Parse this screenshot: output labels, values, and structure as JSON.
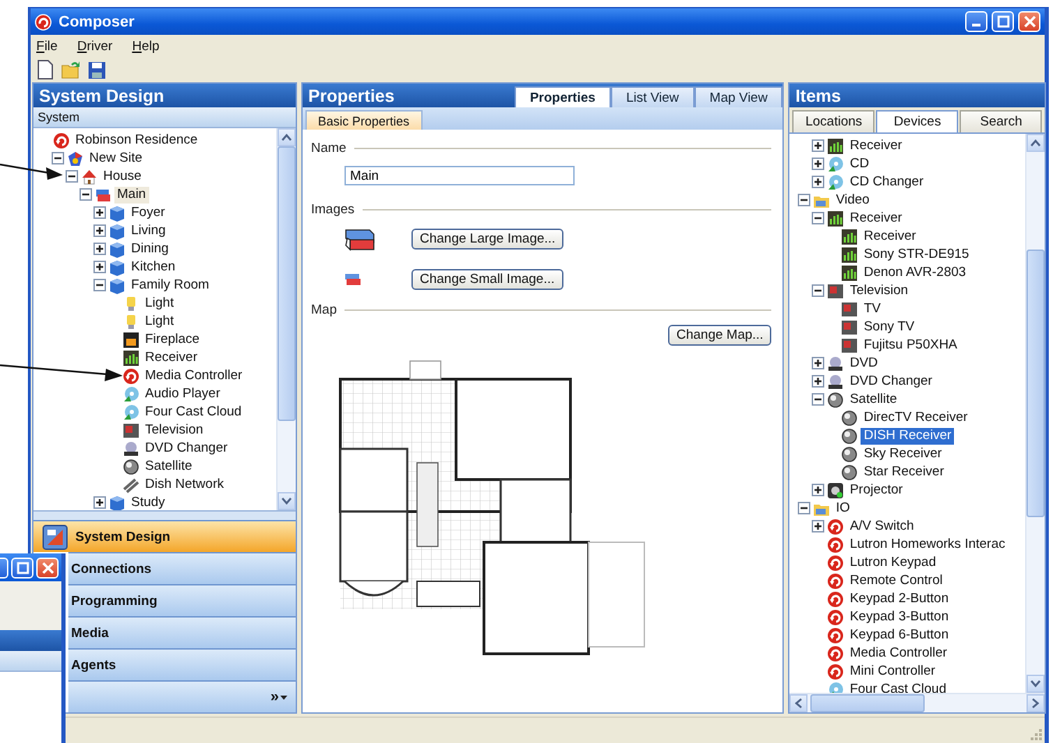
{
  "window": {
    "title": "Composer"
  },
  "menu": [
    "File",
    "Driver",
    "Help"
  ],
  "left_panel": {
    "title": "System Design",
    "subtitle": "System",
    "tree": [
      {
        "label": "Robinson Residence",
        "kind": "logo",
        "expandable": false,
        "selected": false,
        "children": [
          {
            "label": "New Site",
            "kind": "site",
            "expandable": true,
            "expanded": true,
            "selected": false,
            "children": [
              {
                "label": "House",
                "kind": "house",
                "expandable": true,
                "expanded": true,
                "selected": false,
                "children": [
                  {
                    "label": "Main",
                    "kind": "floor",
                    "expandable": true,
                    "expanded": true,
                    "selected": true,
                    "children": [
                      {
                        "label": "Foyer",
                        "kind": "room",
                        "expandable": true,
                        "expanded": false,
                        "selected": false
                      },
                      {
                        "label": "Living",
                        "kind": "room",
                        "expandable": true,
                        "expanded": false,
                        "selected": false
                      },
                      {
                        "label": "Dining",
                        "kind": "room",
                        "expandable": true,
                        "expanded": false,
                        "selected": false
                      },
                      {
                        "label": "Kitchen",
                        "kind": "room",
                        "expandable": true,
                        "expanded": false,
                        "selected": false
                      },
                      {
                        "label": "Family Room",
                        "kind": "room",
                        "expandable": true,
                        "expanded": true,
                        "selected": false,
                        "children": [
                          {
                            "label": "Light",
                            "kind": "light",
                            "expandable": false,
                            "selected": false
                          },
                          {
                            "label": "Light",
                            "kind": "light",
                            "expandable": false,
                            "selected": false
                          },
                          {
                            "label": "Fireplace",
                            "kind": "fireplace",
                            "expandable": false,
                            "selected": false
                          },
                          {
                            "label": "Receiver",
                            "kind": "receiver",
                            "expandable": false,
                            "selected": false
                          },
                          {
                            "label": "Media Controller",
                            "kind": "logo",
                            "expandable": false,
                            "selected": false
                          },
                          {
                            "label": "Audio Player",
                            "kind": "player",
                            "expandable": false,
                            "selected": false
                          },
                          {
                            "label": "Four Cast Cloud",
                            "kind": "player",
                            "expandable": false,
                            "selected": false
                          },
                          {
                            "label": "Television",
                            "kind": "tv",
                            "expandable": false,
                            "selected": false
                          },
                          {
                            "label": "DVD Changer",
                            "kind": "dvd",
                            "expandable": false,
                            "selected": false
                          },
                          {
                            "label": "Satellite",
                            "kind": "satellite",
                            "expandable": false,
                            "selected": false
                          },
                          {
                            "label": "Dish Network",
                            "kind": "cable",
                            "expandable": false,
                            "selected": false
                          }
                        ]
                      },
                      {
                        "label": "Study",
                        "kind": "room",
                        "expandable": true,
                        "expanded": false,
                        "selected": false
                      }
                    ]
                  }
                ]
              }
            ]
          }
        ]
      }
    ],
    "nav": [
      {
        "label": "System Design",
        "selected": true,
        "icon": true
      },
      {
        "label": "Connections",
        "selected": false,
        "icon": false
      },
      {
        "label": "Programming",
        "selected": false,
        "icon": false
      },
      {
        "label": "Media",
        "selected": false,
        "icon": false
      },
      {
        "label": "Agents",
        "selected": false,
        "icon": false
      }
    ],
    "nav_more": "»"
  },
  "properties": {
    "title": "Properties",
    "tabs": [
      {
        "label": "Properties",
        "selected": true
      },
      {
        "label": "List View",
        "selected": false
      },
      {
        "label": "Map View",
        "selected": false
      }
    ],
    "subtabs": [
      {
        "label": "Basic Properties",
        "selected": true
      }
    ],
    "name_label": "Name",
    "name_value": "Main",
    "images_label": "Images",
    "large_button": "Change Large Image...",
    "small_button": "Change Small Image...",
    "map_label": "Map",
    "map_button": "Change Map..."
  },
  "items_panel": {
    "title": "Items",
    "tabs": [
      {
        "label": "Locations",
        "selected": false
      },
      {
        "label": "Devices",
        "selected": true
      },
      {
        "label": "Search",
        "selected": false
      }
    ],
    "tree": [
      {
        "children": [
          {
            "label": "Receiver",
            "kind": "receiver",
            "expandable": true,
            "expanded": false,
            "selected": false
          },
          {
            "label": "CD",
            "kind": "player",
            "expandable": true,
            "expanded": false,
            "selected": false
          },
          {
            "label": "CD Changer",
            "kind": "player",
            "expandable": true,
            "expanded": false,
            "selected": false
          }
        ]
      },
      {
        "label": "Video",
        "kind": "folder",
        "expandable": true,
        "expanded": true,
        "selected": false,
        "children": [
          {
            "label": "Receiver",
            "kind": "receiver",
            "expandable": true,
            "expanded": true,
            "selected": false,
            "children": [
              {
                "label": "Receiver",
                "kind": "receiver",
                "expandable": false,
                "selected": false
              },
              {
                "label": "Sony STR-DE915",
                "kind": "receiver",
                "expandable": false,
                "selected": false
              },
              {
                "label": "Denon AVR-2803",
                "kind": "receiver",
                "expandable": false,
                "selected": false
              }
            ]
          },
          {
            "label": "Television",
            "kind": "tv",
            "expandable": true,
            "expanded": true,
            "selected": false,
            "children": [
              {
                "label": "TV",
                "kind": "tv",
                "expandable": false,
                "selected": false
              },
              {
                "label": "Sony TV",
                "kind": "tv",
                "expandable": false,
                "selected": false
              },
              {
                "label": "Fujitsu P50XHA",
                "kind": "tv",
                "expandable": false,
                "selected": false
              }
            ]
          },
          {
            "label": "DVD",
            "kind": "dvd",
            "expandable": true,
            "expanded": false,
            "selected": false
          },
          {
            "label": "DVD Changer",
            "kind": "dvd",
            "expandable": true,
            "expanded": false,
            "selected": false
          },
          {
            "label": "Satellite",
            "kind": "satellite",
            "expandable": true,
            "expanded": true,
            "selected": false,
            "children": [
              {
                "label": "DirecTV Receiver",
                "kind": "satellite",
                "expandable": false,
                "selected": false
              },
              {
                "label": "DISH Receiver",
                "kind": "satellite",
                "expandable": false,
                "selected": true
              },
              {
                "label": "Sky Receiver",
                "kind": "satellite",
                "expandable": false,
                "selected": false
              },
              {
                "label": "Star Receiver",
                "kind": "satellite",
                "expandable": false,
                "selected": false
              }
            ]
          },
          {
            "label": "Projector",
            "kind": "projector",
            "expandable": true,
            "expanded": false,
            "selected": false
          }
        ]
      },
      {
        "label": "IO",
        "kind": "folder",
        "expandable": true,
        "expanded": true,
        "selected": false,
        "children": [
          {
            "label": "A/V Switch",
            "kind": "logo",
            "expandable": true,
            "expanded": false,
            "selected": false
          },
          {
            "label": "Lutron Homeworks Interac",
            "kind": "logo",
            "expandable": false,
            "selected": false
          },
          {
            "label": "Lutron Keypad",
            "kind": "logo",
            "expandable": false,
            "selected": false
          },
          {
            "label": "Remote Control",
            "kind": "logo",
            "expandable": false,
            "selected": false
          },
          {
            "label": "Keypad 2-Button",
            "kind": "logo",
            "expandable": false,
            "selected": false
          },
          {
            "label": "Keypad 3-Button",
            "kind": "logo",
            "expandable": false,
            "selected": false
          },
          {
            "label": "Keypad 6-Button",
            "kind": "logo",
            "expandable": false,
            "selected": false
          },
          {
            "label": "Media Controller",
            "kind": "logo",
            "expandable": false,
            "selected": false
          },
          {
            "label": "Mini Controller",
            "kind": "logo",
            "expandable": false,
            "selected": false
          },
          {
            "label": "Four Cast Cloud",
            "kind": "player",
            "expandable": false,
            "selected": false
          }
        ]
      }
    ]
  }
}
